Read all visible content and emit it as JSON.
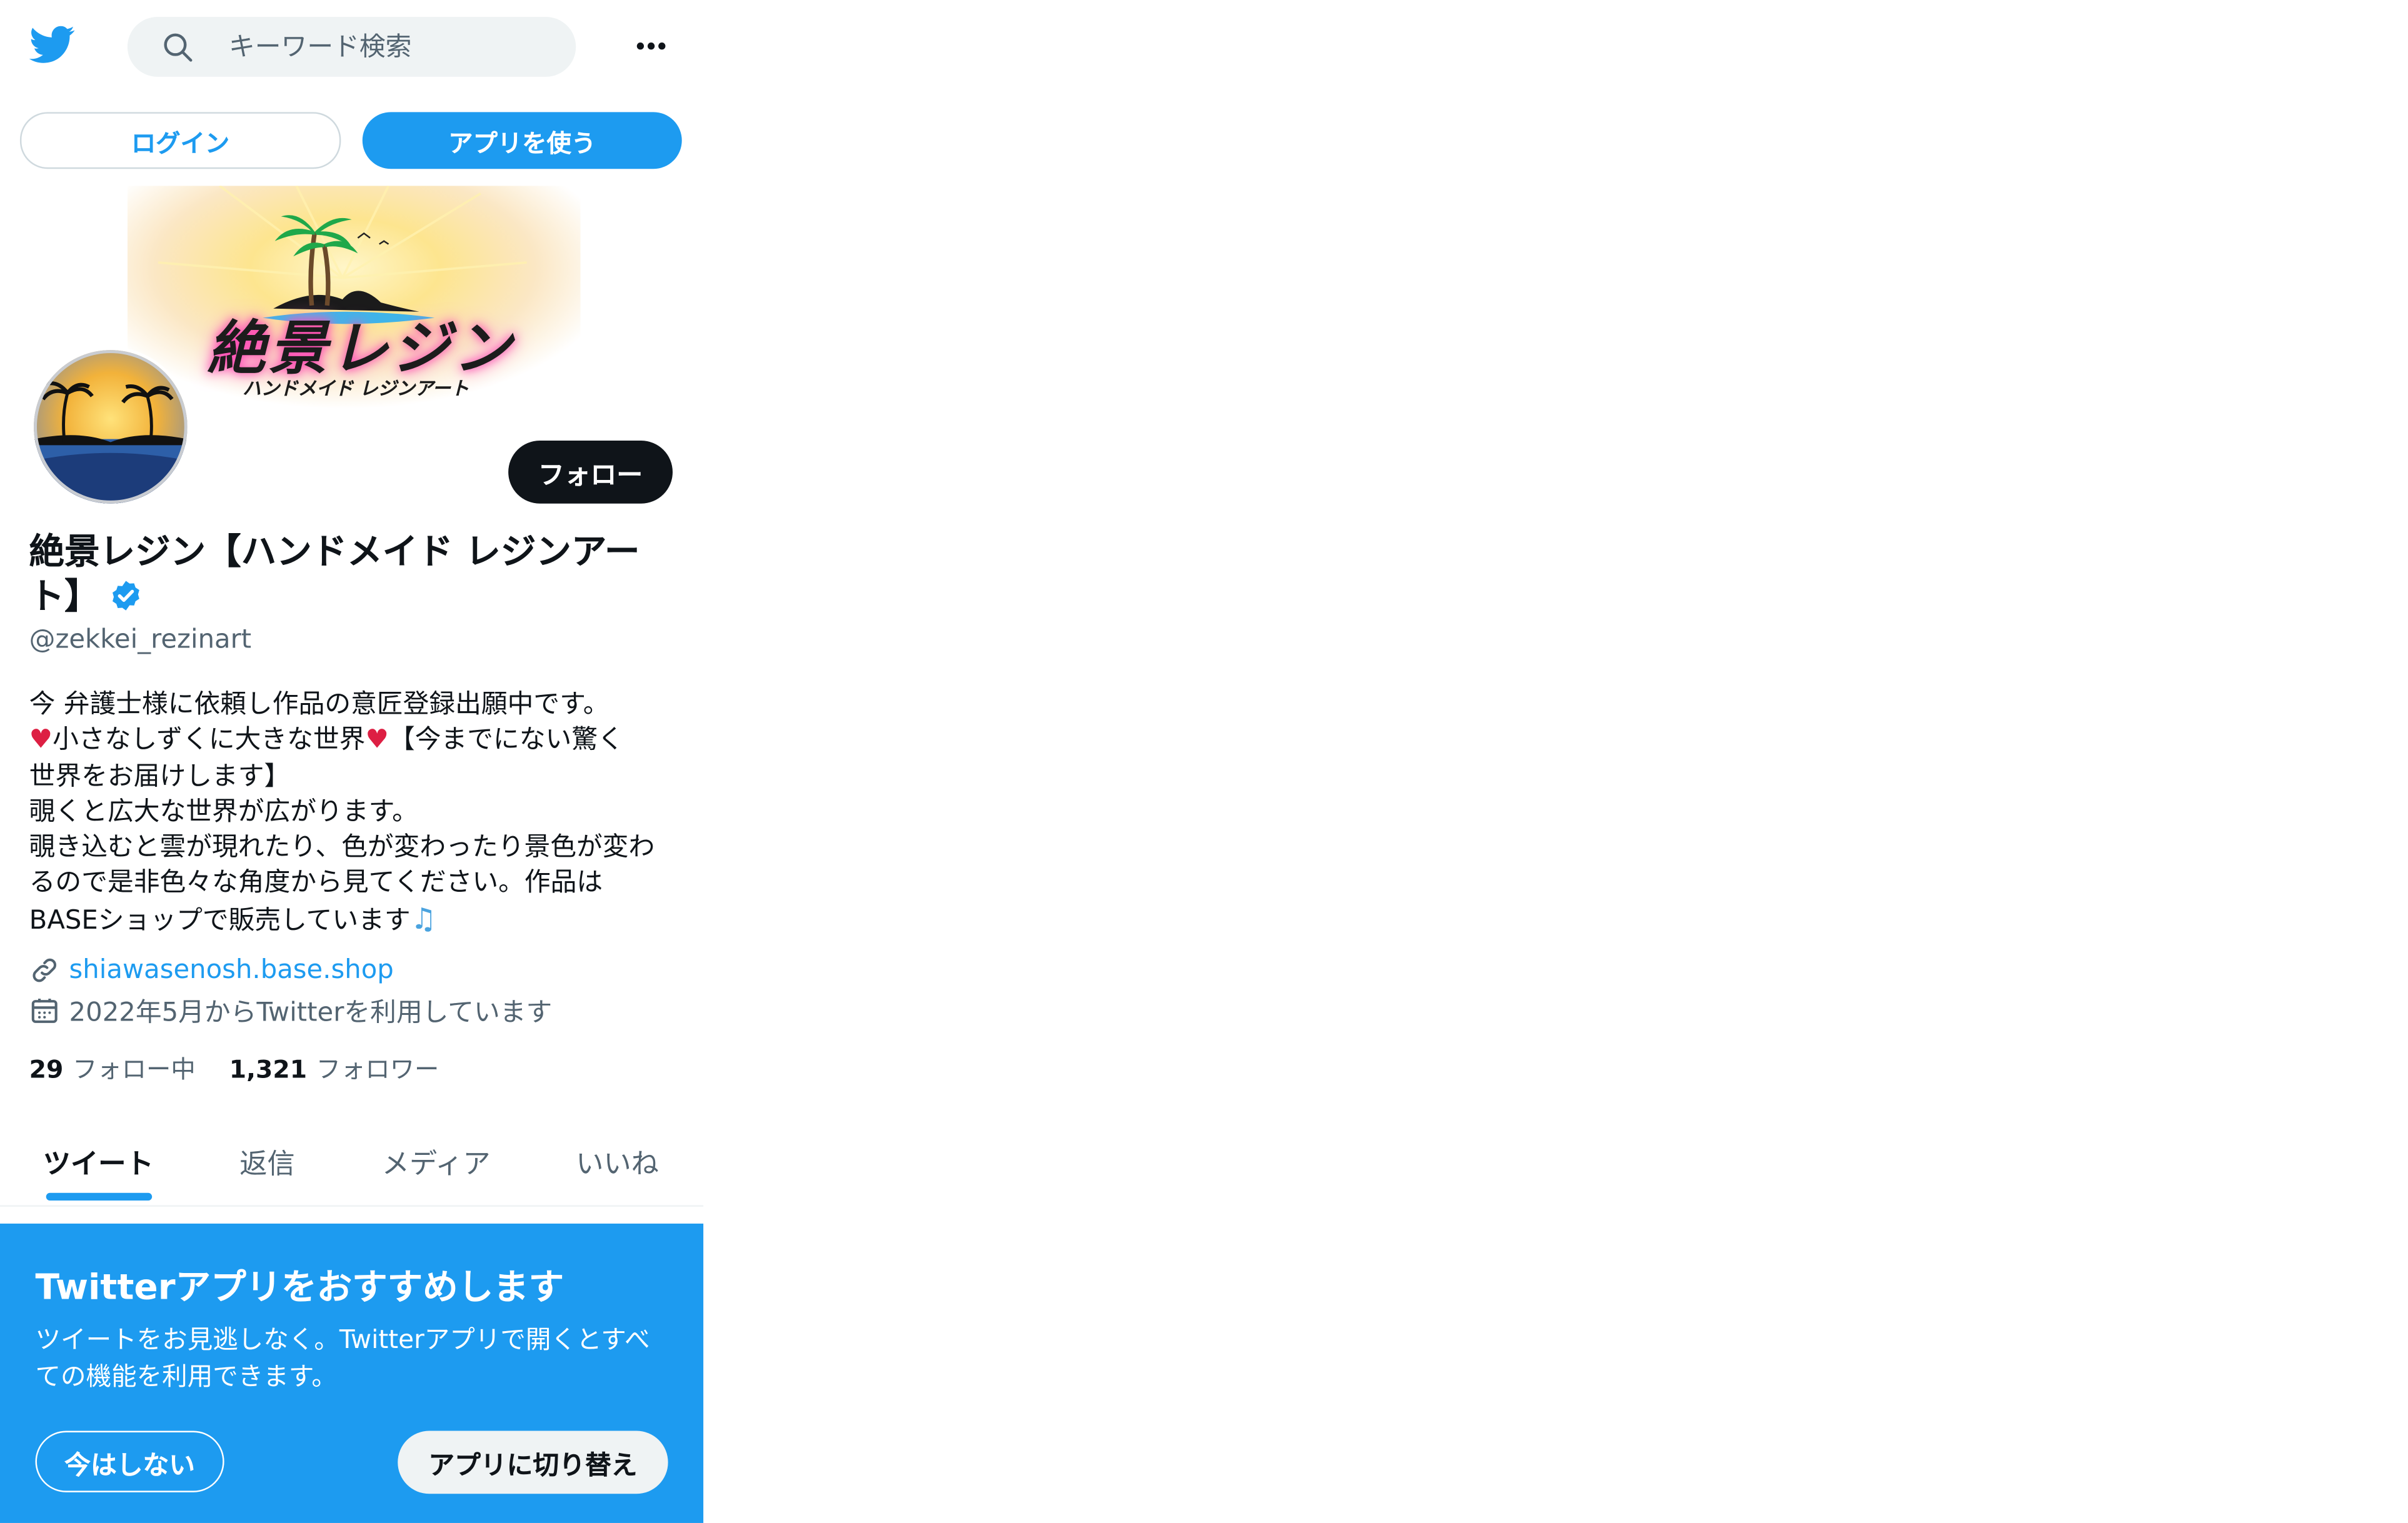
{
  "header": {
    "search_placeholder": "キーワード検索",
    "login_label": "ログイン",
    "use_app_label": "アプリを使う"
  },
  "banner": {
    "title": "絶景レジン",
    "subtitle": "ハンドメイド レジンアート"
  },
  "profile": {
    "follow_label": "フォロー",
    "display_name": "絶景レジン【ハンドメイド レジンアート】",
    "handle": "@zekkei_rezinart",
    "verified": true,
    "bio": {
      "line1": "今 弁護士様に依頼し作品の意匠登録出願中です。",
      "line2_heart_left": "♥",
      "line2_text": "小さなしずくに大きな世界",
      "line2_heart_right": "♥",
      "line2_tail": "【今までにない驚く",
      "line3": "世界をお届けします】",
      "line4": "覗くと広大な世界が広がります。",
      "line5": "覗き込むと雲が現れたり、色が変わったり景色が変わ",
      "line6": "るので是非色々な角度から見てください。作品は",
      "line7": "BASEショップで販売しています",
      "line7_emoji": "♫"
    },
    "website": "shiawasenosh.base.shop",
    "joined": "2022年5月からTwitterを利用しています",
    "following_count": "29",
    "following_label": "フォロー中",
    "followers_count": "1,321",
    "followers_label": "フォロワー"
  },
  "tabs": [
    {
      "label": "ツイート",
      "active": true
    },
    {
      "label": "返信",
      "active": false
    },
    {
      "label": "メディア",
      "active": false
    },
    {
      "label": "いいね",
      "active": false
    }
  ],
  "promo": {
    "title": "Twitterアプリをおすすめします",
    "text": "ツイートをお見逃しなく。Twitterアプリで開くとすべての機能を利用できます。",
    "not_now_label": "今はしない",
    "switch_label": "アプリに切り替え"
  },
  "colors": {
    "accent": "#1d9bf0",
    "text": "#0f1419",
    "secondary_text": "#536471",
    "heart": "#dd1f43"
  },
  "icons": [
    "twitter-bird-icon",
    "search-icon",
    "more-icon",
    "verified-badge-icon",
    "link-icon",
    "calendar-icon"
  ]
}
